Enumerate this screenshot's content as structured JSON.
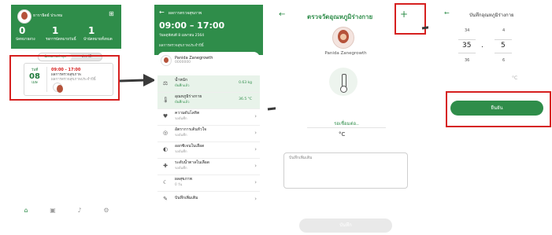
{
  "screen1": {
    "user_name": "ธาราธิดย์ ประทม",
    "stats": [
      {
        "value": "0",
        "label": "นัดหมายล่วง"
      },
      {
        "value": "1",
        "label": "รอการนัดหมายวันนี้"
      },
      {
        "value": "1",
        "label": "นำนัดหมายทั้งหมด"
      }
    ],
    "tabs": [
      "นัดหมายล่าสุด",
      "ประวัติ"
    ],
    "appointment": {
      "day": "วันที่",
      "date": "08",
      "month": "เมษ",
      "time": "09:00 - 17:00",
      "title": "ผลการตรวจสุขภาพ",
      "subtitle": "ผลการตรวจสุขภาพประจำปีนี้"
    }
  },
  "screen2": {
    "header_title": "ผลการตรวจสุขภาพ",
    "time": "09:00 – 17:00",
    "date": "วันพฤหัสบดี 8 เมษายน 2564",
    "note": "ผลการตรวจสุขภาพประจำปีนี้",
    "patient": {
      "name": "Panida Zanegrowth",
      "sub": "0000000"
    },
    "rows": [
      {
        "icon": "weight-icon",
        "glyph": "⚖",
        "title": "น้ำหนัก",
        "sub": "บันทึกแล้ว",
        "value": "0.63 kg"
      },
      {
        "icon": "thermometer-icon",
        "glyph": "🌡",
        "title": "อุณหภูมิร่างกาย",
        "sub": "บันทึกแล้ว",
        "value": "36.5 °C"
      },
      {
        "icon": "blood-pressure-icon",
        "glyph": "♥",
        "title": "ความดันโลหิต",
        "sub": "รอบันทึก",
        "value": ""
      },
      {
        "icon": "pulse-icon",
        "glyph": "◎",
        "title": "อัตราการเต้นหัวใจ",
        "sub": "รอบันทึก",
        "value": ""
      },
      {
        "icon": "oxygen-icon",
        "glyph": "◐",
        "title": "ออกซิเจนในเลือด",
        "sub": "รอบันทึก",
        "value": ""
      },
      {
        "icon": "glucose-icon",
        "glyph": "✚",
        "title": "ระดับน้ำตาลในเลือด",
        "sub": "รอบันทึก",
        "value": ""
      },
      {
        "icon": "sleep-icon",
        "glyph": "☾",
        "title": "ผลสุขภาพ",
        "sub": "0 วัน",
        "value": ""
      },
      {
        "icon": "notes-icon",
        "glyph": "✎",
        "title": "บันทึกเพิ่มเติม",
        "sub": "",
        "value": ""
      }
    ]
  },
  "screen3": {
    "title": "ตรวจวัดอุณหภูมิร่างกาย",
    "plus": "+",
    "patient_name": "Panida Zanegrowth",
    "status": "รอเชื่อมต่อ..",
    "unit": "°C",
    "notes_label": "บันทึกเพิ่มเติม",
    "save_label": "บันทึก"
  },
  "screen4": {
    "title": "บันทึกอุณหภูมิร่างกาย",
    "picker_left": [
      "34",
      "35",
      "36"
    ],
    "picker_right": [
      "4",
      "5",
      "6"
    ],
    "separator": ".",
    "unit": "°C",
    "confirm_label": "ยืนยัน"
  },
  "colors": {
    "primary": "#2f8d4a",
    "highlight": "#d6201f"
  }
}
